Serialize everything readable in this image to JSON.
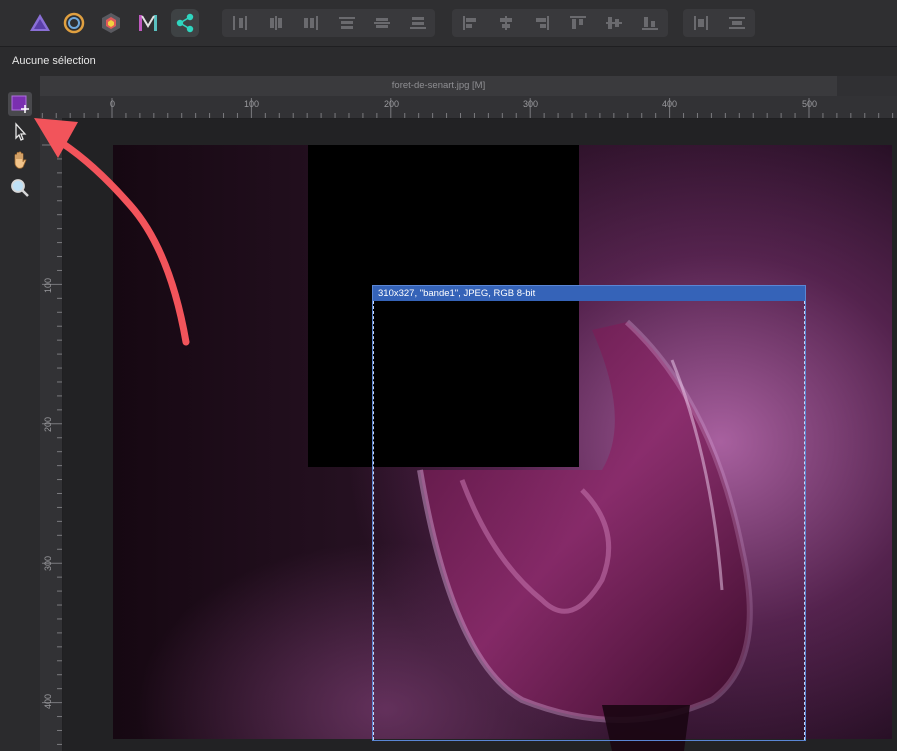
{
  "toolbar": {
    "personas": [
      {
        "name": "photo-persona"
      },
      {
        "name": "liquify-persona"
      },
      {
        "name": "develop-persona"
      },
      {
        "name": "tone-mapping-persona"
      },
      {
        "name": "export-persona",
        "active": true
      }
    ]
  },
  "context": {
    "label": "Aucune sélection"
  },
  "document": {
    "tab_title": "foret-de-senart.jpg [M]"
  },
  "rulers": {
    "unit": "px",
    "h_labels": [
      "0",
      "100",
      "200",
      "300",
      "400",
      "500"
    ],
    "v_labels": [
      "100",
      "200",
      "300",
      "400"
    ]
  },
  "slice": {
    "info": "310x327, \"bande1\", JPEG, RGB 8-bit"
  },
  "tools": [
    {
      "name": "slice-tool",
      "active": true
    },
    {
      "name": "slice-selection-tool"
    },
    {
      "name": "view-tool"
    },
    {
      "name": "zoom-tool"
    }
  ],
  "colors": {
    "accent": "#3563b8",
    "arrow": "#f2545b",
    "slice_tool": "#7a2fb0"
  }
}
